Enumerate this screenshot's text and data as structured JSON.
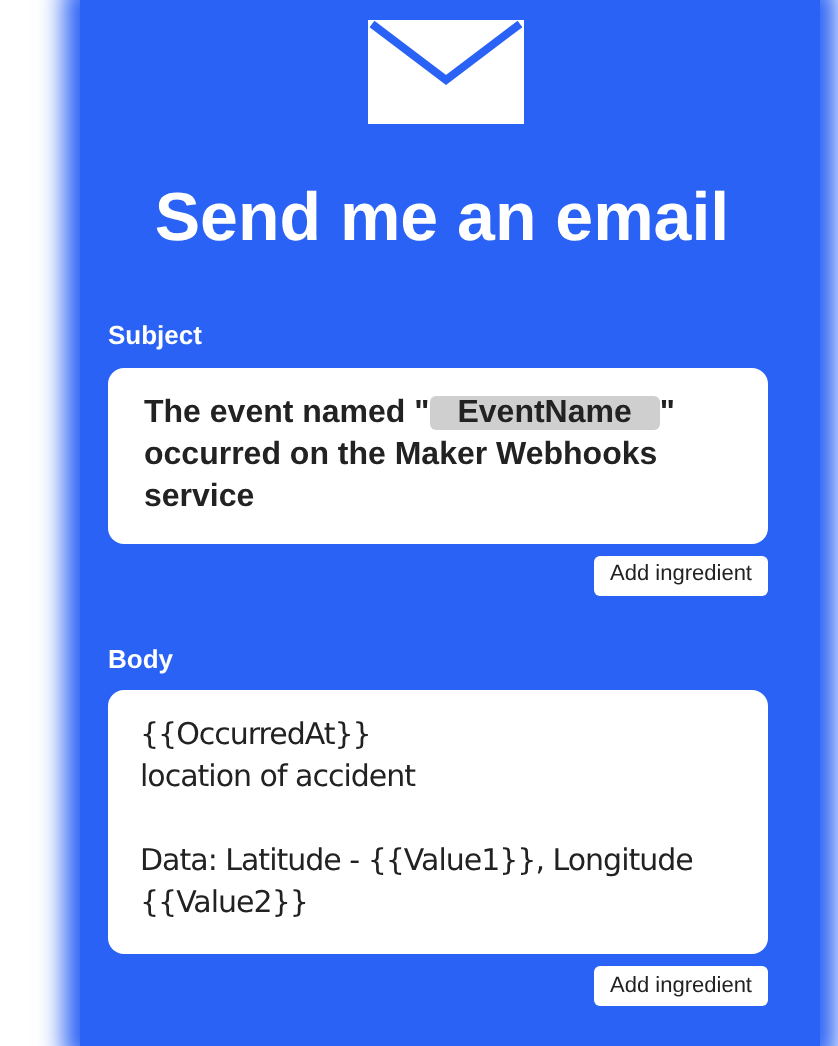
{
  "title": "Send me an email",
  "subject": {
    "label": "Subject",
    "text_before": "The event named \"",
    "ingredient": "EventName",
    "text_after": "\" occurred on the Maker Webhooks service",
    "button": "Add ingredient"
  },
  "body": {
    "label": "Body",
    "paragraphs": [
      "{{OccurredAt}}\nlocation of accident",
      "Data: Latitude - {{Value1}}, Longitude {{Value2}}"
    ],
    "button": "Add ingredient"
  }
}
